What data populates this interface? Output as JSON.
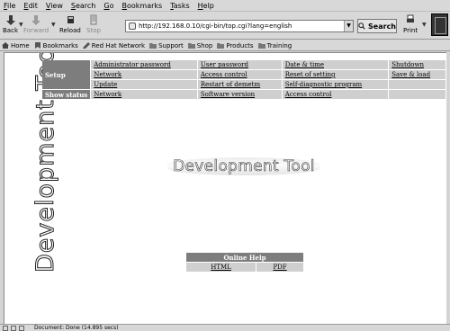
{
  "menubar": [
    "File",
    "Edit",
    "View",
    "Search",
    "Go",
    "Bookmarks",
    "Tasks",
    "Help"
  ],
  "toolbar": {
    "back": "Back",
    "forward": "Forward",
    "reload": "Reload",
    "stop": "Stop",
    "url": "http://192.168.0.10/cgi-bin/top.cgi?lang=english",
    "search": "Search",
    "print": "Print"
  },
  "personal_toolbar": [
    "Home",
    "Bookmarks",
    "Red Hat Network",
    "Support",
    "Shop",
    "Products",
    "Training"
  ],
  "sidebar": {
    "title": "Development Tool"
  },
  "menu": {
    "setup_label": "Setup",
    "show_status_label": "Show status",
    "rows": [
      [
        "Administrator password",
        "User password",
        "Date & time",
        "Shutdown"
      ],
      [
        "Network",
        "Access control",
        "Reset of setting",
        "Save & load"
      ],
      [
        "Update",
        "Restart of demetm",
        "Self-diagnostic program",
        ""
      ],
      [
        "Network",
        "Software version",
        "Access control",
        ""
      ]
    ]
  },
  "banner": {
    "title": "Development Tool"
  },
  "help": {
    "title": "Online Help",
    "links": [
      "HTML",
      "PDF"
    ]
  },
  "status": {
    "text": "Document: Done (14.895 secs)"
  }
}
